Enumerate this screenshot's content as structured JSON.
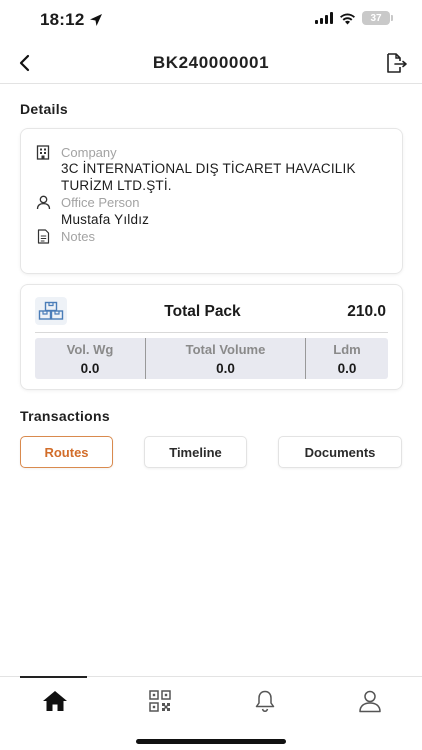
{
  "status_bar": {
    "time": "18:12",
    "battery": "37"
  },
  "header": {
    "title": "BK240000001"
  },
  "details": {
    "section_title": "Details",
    "company_label": "Company",
    "company_value_line1": "3C İNTERNATİONAL DIŞ TİCARET HAVACILIK",
    "company_value_line2": "TURİZM LTD.ŞTİ.",
    "office_label": "Office Person",
    "office_value": "Mustafa Yıldız",
    "notes_label": "Notes"
  },
  "pack": {
    "label": "Total Pack",
    "value": "210.0",
    "stats": [
      {
        "label": "Vol. Wg",
        "value": "0.0"
      },
      {
        "label": "Total Volume",
        "value": "0.0"
      },
      {
        "label": "Ldm",
        "value": "0.0"
      }
    ]
  },
  "transactions": {
    "section_title": "Transactions",
    "tabs": [
      {
        "label": "Routes",
        "active": true
      },
      {
        "label": "Timeline",
        "active": false
      },
      {
        "label": "Documents",
        "active": false
      }
    ]
  },
  "bottom_nav": {
    "items": [
      "home-icon",
      "qr-code-icon",
      "bell-icon",
      "user-icon"
    ],
    "active": "home-icon"
  },
  "colors": {
    "accent": "#d26d2a",
    "stats_bg": "#e8e9f0",
    "border": "#e6e6e6"
  }
}
